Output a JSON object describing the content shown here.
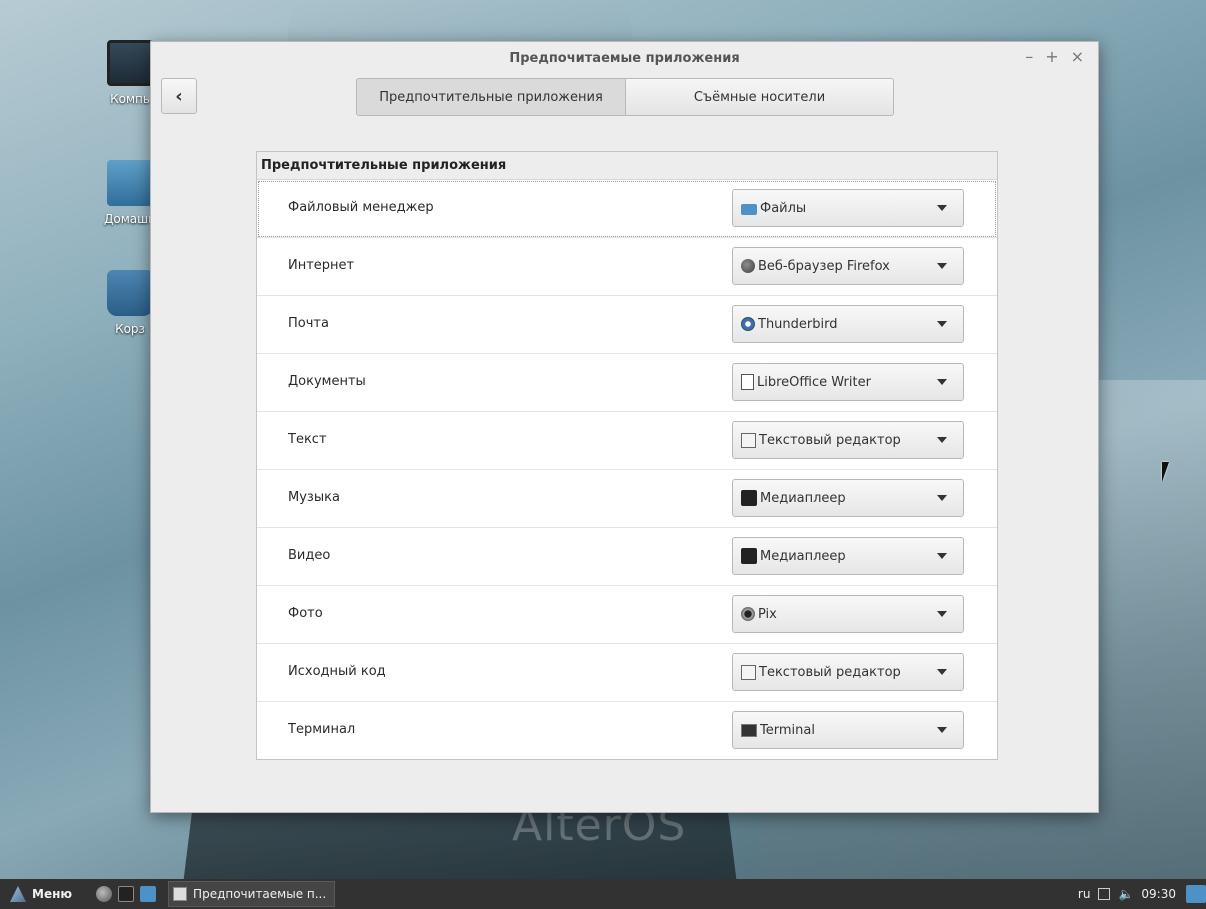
{
  "desktop": {
    "icons": [
      {
        "label": "Компь",
        "icon": "computer-icon"
      },
      {
        "label": "Домашн",
        "icon": "home-folder-icon"
      },
      {
        "label": "Корз",
        "icon": "trash-icon"
      }
    ],
    "watermark": "AlterOS"
  },
  "window": {
    "title": "Предпочитаемые приложения",
    "controls": {
      "minimize": "–",
      "maximize": "+",
      "close": "×"
    },
    "back_label": "‹",
    "tabs": [
      {
        "label": "Предпочтительные приложения",
        "active": true
      },
      {
        "label": "Съёмные носители",
        "active": false
      }
    ],
    "panel_title": "Предпочтительные приложения",
    "rows": [
      {
        "label": "Файловый менеджер",
        "app": "Файлы",
        "icon": "folder-icon"
      },
      {
        "label": "Интернет",
        "app": "Веб-браузер Firefox",
        "icon": "firefox-icon"
      },
      {
        "label": "Почта",
        "app": "Thunderbird",
        "icon": "thunderbird-icon"
      },
      {
        "label": "Документы",
        "app": "LibreOffice Writer",
        "icon": "writer-document-icon"
      },
      {
        "label": "Текст",
        "app": "Текстовый редактор",
        "icon": "text-editor-icon"
      },
      {
        "label": "Музыка",
        "app": "Медиаплеер",
        "icon": "media-player-icon"
      },
      {
        "label": "Видео",
        "app": "Медиаплеер",
        "icon": "media-player-icon"
      },
      {
        "label": "Фото",
        "app": "Pix",
        "icon": "pix-camera-icon"
      },
      {
        "label": "Исходный код",
        "app": "Текстовый редактор",
        "icon": "text-editor-icon"
      },
      {
        "label": "Терминал",
        "app": "Terminal",
        "icon": "terminal-icon"
      }
    ]
  },
  "taskbar": {
    "menu_label": "Меню",
    "task_label": "Предпочитаемые п...",
    "keyboard_layout": "ru",
    "volume": "🔈",
    "clock": "09:30"
  }
}
